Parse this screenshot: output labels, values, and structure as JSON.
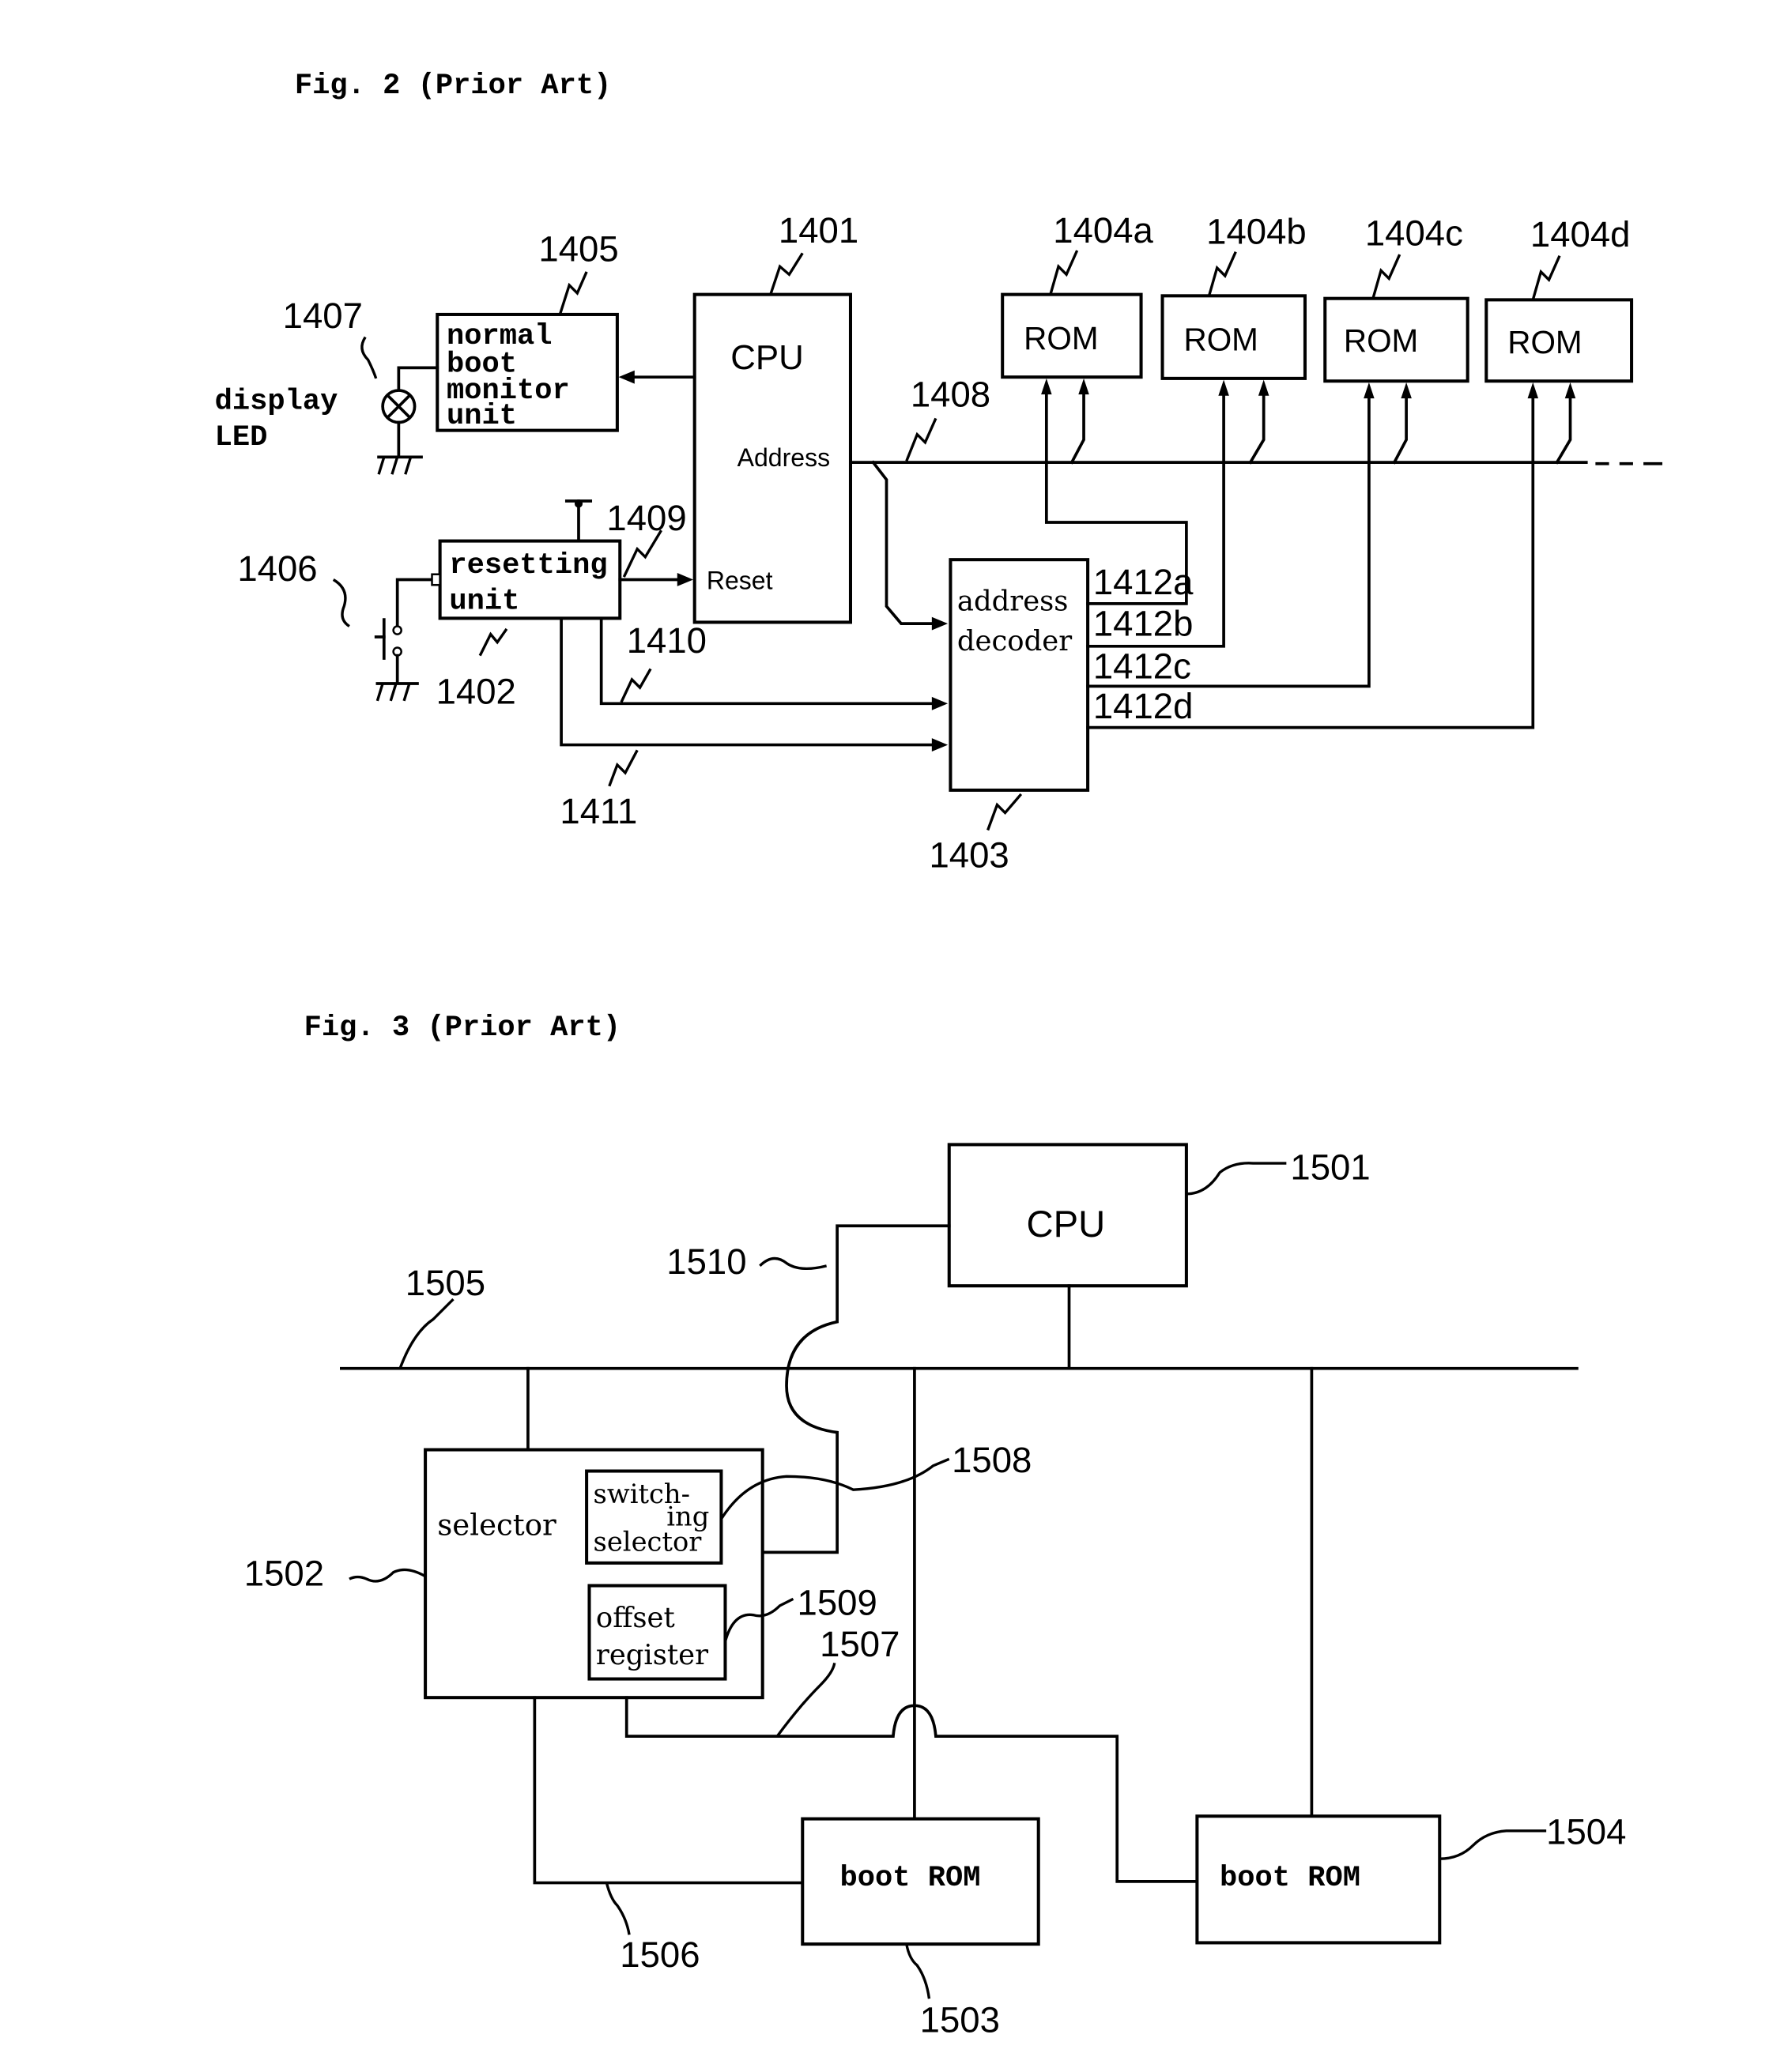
{
  "fig2": {
    "title": "Fig. 2 (Prior Art)",
    "cpu": {
      "label": "CPU",
      "address_port": "Address",
      "reset_port": "Reset",
      "ref": "1401"
    },
    "normal_boot_monitor": {
      "lines": [
        "normal",
        "boot",
        "monitor",
        "unit"
      ],
      "ref": "1405"
    },
    "display_led": {
      "lines": [
        "display",
        "LED"
      ],
      "ref": "1407"
    },
    "resetting_unit": {
      "lines": [
        "resetting",
        "unit"
      ],
      "ref": "1402"
    },
    "reset_switch": {
      "ref": "1406"
    },
    "address_decoder": {
      "lines": [
        "address",
        "decoder"
      ],
      "ref": "1403"
    },
    "roms": [
      {
        "label": "ROM",
        "ref": "1404a"
      },
      {
        "label": "ROM",
        "ref": "1404b"
      },
      {
        "label": "ROM",
        "ref": "1404c"
      },
      {
        "label": "ROM",
        "ref": "1404d"
      }
    ],
    "address_bus_ref": "1408",
    "reset_line_ref": "1409",
    "signal_1410_ref": "1410",
    "signal_1411_ref": "1411",
    "select_lines": [
      "1412a",
      "1412b",
      "1412c",
      "1412d"
    ]
  },
  "fig3": {
    "title": "Fig. 3 (Prior Art)",
    "cpu": {
      "label": "CPU",
      "ref": "1501"
    },
    "bus_ref": "1505",
    "line_1510_ref": "1510",
    "selector": {
      "label": "selector",
      "ref": "1502"
    },
    "switching_selector": {
      "lines": [
        "switch-",
        "ing",
        "selector"
      ],
      "ref": "1508"
    },
    "offset_register": {
      "lines": [
        "offset",
        "register"
      ],
      "ref": "1509"
    },
    "line_1507_ref": "1507",
    "line_1506_ref": "1506",
    "boot_rom_1": {
      "label": "boot ROM",
      "ref": "1503"
    },
    "boot_rom_2": {
      "label": "boot ROM",
      "ref": "1504"
    }
  }
}
